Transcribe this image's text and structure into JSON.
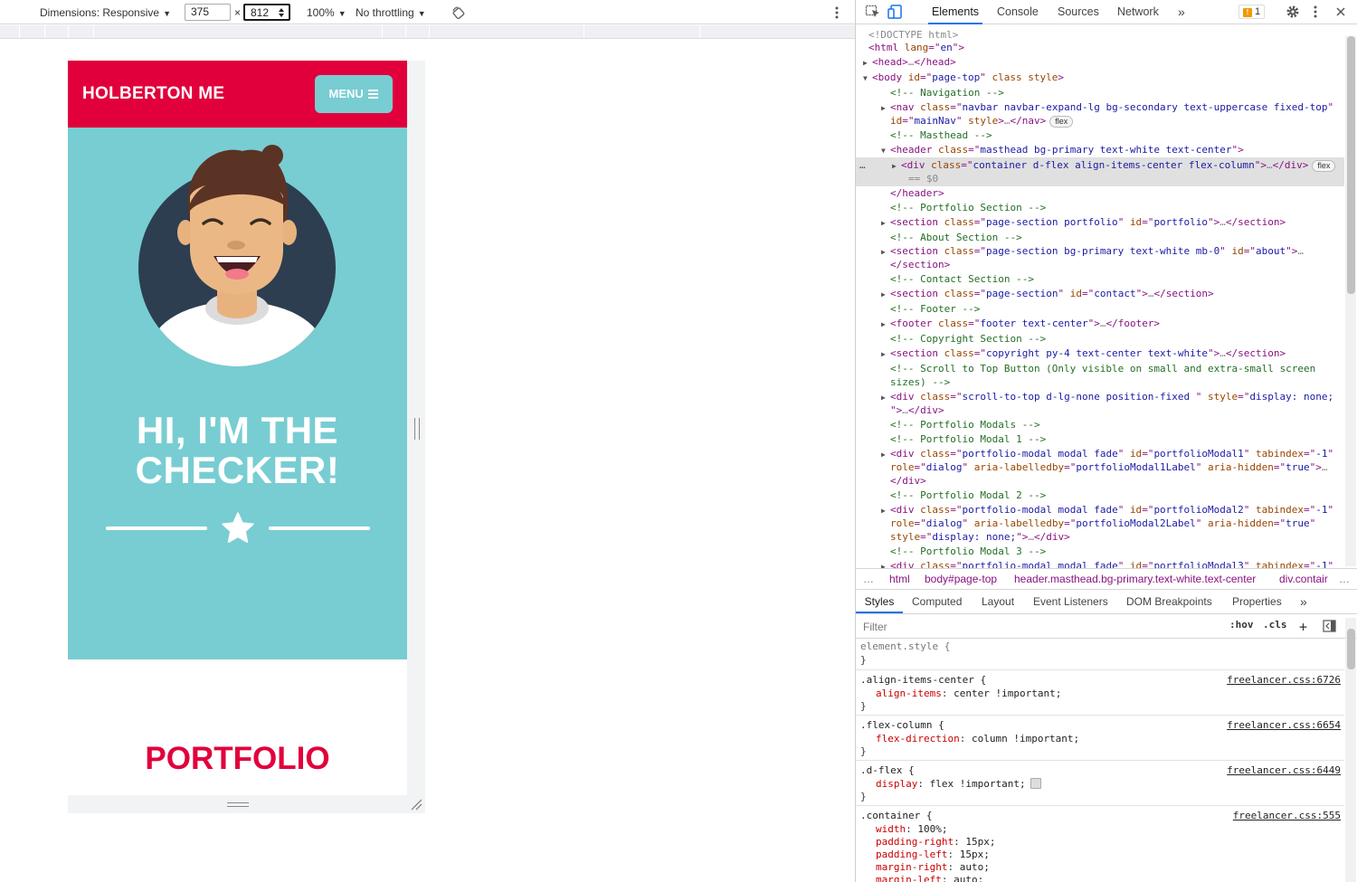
{
  "device_toolbar": {
    "dimensions_label": "Dimensions: Responsive",
    "width_value": "375",
    "times_sign": "×",
    "height_value": "812",
    "zoom_label": "100%",
    "throttling_label": "No throttling",
    "rotate_icon": "rotate-icon",
    "more_icon": "more-vertical-icon"
  },
  "site": {
    "brand": "HOLBERTON ME",
    "menu_label": "MENU",
    "menu_icon": "hamburger-icon",
    "headline_line1": "HI, I'M THE",
    "headline_line2": "CHECKER!",
    "divider_icon": "star-icon",
    "portfolio_title": "PORTFOLIO",
    "colors": {
      "primary": "#e1003c",
      "secondary": "#78cdd2",
      "avatar_bg": "#2d3e50"
    }
  },
  "devtools": {
    "tabs": [
      "Elements",
      "Console",
      "Sources",
      "Network"
    ],
    "active_tab": "Elements",
    "more_tabs": "»",
    "issues_count": "1",
    "dom_lines": [
      {
        "segs": [
          [
            "p",
            "<!DOCTYPE html>"
          ]
        ]
      },
      {
        "segs": [
          [
            "t",
            "<html "
          ],
          [
            "a",
            "lang"
          ],
          [
            "t",
            "=\""
          ],
          [
            "v",
            "en"
          ],
          [
            "t",
            "\">"
          ]
        ]
      },
      {
        "segs": [
          [
            "t",
            "<head>"
          ],
          [
            "p",
            "…"
          ],
          [
            "t",
            "</head>"
          ]
        ]
      },
      {
        "segs": [
          [
            "t",
            "<body "
          ],
          [
            "a",
            "id"
          ],
          [
            "t",
            "=\""
          ],
          [
            "v",
            "page-top"
          ],
          [
            "t",
            "\" "
          ],
          [
            "a",
            "class style"
          ],
          [
            "t",
            ">"
          ]
        ]
      },
      {
        "segs": [
          [
            "c",
            "<!-- Navigation -->"
          ]
        ]
      },
      {
        "segs": [
          [
            "t",
            "<nav "
          ],
          [
            "a",
            "class"
          ],
          [
            "t",
            "=\""
          ],
          [
            "v",
            "navbar navbar-expand-lg bg-secondary text-uppercase fixed-top"
          ],
          [
            "t",
            "\""
          ]
        ]
      },
      {
        "segs": [
          [
            "a",
            "id"
          ],
          [
            "t",
            "=\""
          ],
          [
            "v",
            "mainNav"
          ],
          [
            "t",
            "\" "
          ],
          [
            "a",
            "style"
          ],
          [
            "t",
            ">"
          ],
          [
            "p",
            "…"
          ],
          [
            "t",
            "</nav>"
          ]
        ],
        "badge": "flex"
      },
      {
        "segs": [
          [
            "c",
            "<!-- Masthead -->"
          ]
        ]
      },
      {
        "segs": [
          [
            "t",
            "<header "
          ],
          [
            "a",
            "class"
          ],
          [
            "t",
            "=\""
          ],
          [
            "v",
            "masthead bg-primary text-white text-center"
          ],
          [
            "t",
            "\">"
          ]
        ]
      },
      {
        "segs": [
          [
            "t",
            "<div "
          ],
          [
            "a",
            "class"
          ],
          [
            "t",
            "=\""
          ],
          [
            "v",
            "container d-flex align-items-center flex-column"
          ],
          [
            "t",
            "\">"
          ],
          [
            "p",
            "…"
          ],
          [
            "t",
            "</div>"
          ]
        ],
        "badge": "flex"
      },
      {
        "segs": [
          [
            "p",
            "== $0"
          ]
        ]
      },
      {
        "segs": [
          [
            "t",
            "</header>"
          ]
        ]
      },
      {
        "segs": [
          [
            "c",
            "<!-- Portfolio Section -->"
          ]
        ]
      },
      {
        "segs": [
          [
            "t",
            "<section "
          ],
          [
            "a",
            "class"
          ],
          [
            "t",
            "=\""
          ],
          [
            "v",
            "page-section portfolio"
          ],
          [
            "t",
            "\" "
          ],
          [
            "a",
            "id"
          ],
          [
            "t",
            "=\""
          ],
          [
            "v",
            "portfolio"
          ],
          [
            "t",
            "\">"
          ],
          [
            "p",
            "…"
          ],
          [
            "t",
            "</section>"
          ]
        ]
      },
      {
        "segs": [
          [
            "c",
            "<!-- About Section -->"
          ]
        ]
      },
      {
        "segs": [
          [
            "t",
            "<section "
          ],
          [
            "a",
            "class"
          ],
          [
            "t",
            "=\""
          ],
          [
            "v",
            "page-section bg-primary text-white mb-0"
          ],
          [
            "t",
            "\" "
          ],
          [
            "a",
            "id"
          ],
          [
            "t",
            "=\""
          ],
          [
            "v",
            "about"
          ],
          [
            "t",
            "\">"
          ],
          [
            "p",
            "…"
          ]
        ]
      },
      {
        "segs": [
          [
            "t",
            "</section>"
          ]
        ]
      },
      {
        "segs": [
          [
            "c",
            "<!-- Contact Section -->"
          ]
        ]
      },
      {
        "segs": [
          [
            "t",
            "<section "
          ],
          [
            "a",
            "class"
          ],
          [
            "t",
            "=\""
          ],
          [
            "v",
            "page-section"
          ],
          [
            "t",
            "\" "
          ],
          [
            "a",
            "id"
          ],
          [
            "t",
            "=\""
          ],
          [
            "v",
            "contact"
          ],
          [
            "t",
            "\">"
          ],
          [
            "p",
            "…"
          ],
          [
            "t",
            "</section>"
          ]
        ]
      },
      {
        "segs": [
          [
            "c",
            "<!-- Footer -->"
          ]
        ]
      },
      {
        "segs": [
          [
            "t",
            "<footer "
          ],
          [
            "a",
            "class"
          ],
          [
            "t",
            "=\""
          ],
          [
            "v",
            "footer text-center"
          ],
          [
            "t",
            "\">"
          ],
          [
            "p",
            "…"
          ],
          [
            "t",
            "</footer>"
          ]
        ]
      },
      {
        "segs": [
          [
            "c",
            "<!-- Copyright Section -->"
          ]
        ]
      },
      {
        "segs": [
          [
            "t",
            "<section "
          ],
          [
            "a",
            "class"
          ],
          [
            "t",
            "=\""
          ],
          [
            "v",
            "copyright py-4 text-center text-white"
          ],
          [
            "t",
            "\">"
          ],
          [
            "p",
            "…"
          ],
          [
            "t",
            "</section>"
          ]
        ]
      },
      {
        "segs": [
          [
            "c",
            "<!-- Scroll to Top Button (Only visible on small and extra-small screen"
          ]
        ]
      },
      {
        "segs": [
          [
            "c",
            "sizes) -->"
          ]
        ]
      },
      {
        "segs": [
          [
            "t",
            "<div "
          ],
          [
            "a",
            "class"
          ],
          [
            "t",
            "=\""
          ],
          [
            "v",
            "scroll-to-top d-lg-none position-fixed "
          ],
          [
            "t",
            "\" "
          ],
          [
            "a",
            "style"
          ],
          [
            "t",
            "=\""
          ],
          [
            "v",
            "display: none;"
          ]
        ]
      },
      {
        "segs": [
          [
            "t",
            "\">"
          ],
          [
            "p",
            "…"
          ],
          [
            "t",
            "</div>"
          ]
        ]
      },
      {
        "segs": [
          [
            "c",
            "<!-- Portfolio Modals -->"
          ]
        ]
      },
      {
        "segs": [
          [
            "c",
            "<!-- Portfolio Modal 1 -->"
          ]
        ]
      },
      {
        "segs": [
          [
            "t",
            "<div "
          ],
          [
            "a",
            "class"
          ],
          [
            "t",
            "=\""
          ],
          [
            "v",
            "portfolio-modal modal fade"
          ],
          [
            "t",
            "\" "
          ],
          [
            "a",
            "id"
          ],
          [
            "t",
            "=\""
          ],
          [
            "v",
            "portfolioModal1"
          ],
          [
            "t",
            "\" "
          ],
          [
            "a",
            "tabindex"
          ],
          [
            "t",
            "=\""
          ],
          [
            "v",
            "-1"
          ],
          [
            "t",
            "\""
          ]
        ]
      },
      {
        "segs": [
          [
            "a",
            "role"
          ],
          [
            "t",
            "=\""
          ],
          [
            "v",
            "dialog"
          ],
          [
            "t",
            "\" "
          ],
          [
            "a",
            "aria-labelledby"
          ],
          [
            "t",
            "=\""
          ],
          [
            "v",
            "portfolioModal1Label"
          ],
          [
            "t",
            "\" "
          ],
          [
            "a",
            "aria-hidden"
          ],
          [
            "t",
            "=\""
          ],
          [
            "v",
            "true"
          ],
          [
            "t",
            "\">"
          ],
          [
            "p",
            "…"
          ]
        ]
      },
      {
        "segs": [
          [
            "t",
            "</div>"
          ]
        ]
      },
      {
        "segs": [
          [
            "c",
            "<!-- Portfolio Modal 2 -->"
          ]
        ]
      },
      {
        "segs": [
          [
            "t",
            "<div "
          ],
          [
            "a",
            "class"
          ],
          [
            "t",
            "=\""
          ],
          [
            "v",
            "portfolio-modal modal fade"
          ],
          [
            "t",
            "\" "
          ],
          [
            "a",
            "id"
          ],
          [
            "t",
            "=\""
          ],
          [
            "v",
            "portfolioModal2"
          ],
          [
            "t",
            "\" "
          ],
          [
            "a",
            "tabindex"
          ],
          [
            "t",
            "=\""
          ],
          [
            "v",
            "-1"
          ],
          [
            "t",
            "\""
          ]
        ]
      },
      {
        "segs": [
          [
            "a",
            "role"
          ],
          [
            "t",
            "=\""
          ],
          [
            "v",
            "dialog"
          ],
          [
            "t",
            "\" "
          ],
          [
            "a",
            "aria-labelledby"
          ],
          [
            "t",
            "=\""
          ],
          [
            "v",
            "portfolioModal2Label"
          ],
          [
            "t",
            "\" "
          ],
          [
            "a",
            "aria-hidden"
          ],
          [
            "t",
            "=\""
          ],
          [
            "v",
            "true"
          ],
          [
            "t",
            "\""
          ]
        ]
      },
      {
        "segs": [
          [
            "a",
            "style"
          ],
          [
            "t",
            "=\""
          ],
          [
            "v",
            "display: none;"
          ],
          [
            "t",
            "\">"
          ],
          [
            "p",
            "…"
          ],
          [
            "t",
            "</div>"
          ]
        ]
      },
      {
        "segs": [
          [
            "c",
            "<!-- Portfolio Modal 3 -->"
          ]
        ]
      },
      {
        "segs": [
          [
            "t",
            "<div "
          ],
          [
            "a",
            "class"
          ],
          [
            "t",
            "=\""
          ],
          [
            "v",
            "portfolio-modal modal fade"
          ],
          [
            "t",
            "\" "
          ],
          [
            "a",
            "id"
          ],
          [
            "t",
            "=\""
          ],
          [
            "v",
            "portfolioModal3"
          ],
          [
            "t",
            "\" "
          ],
          [
            "a",
            "tabindex"
          ],
          [
            "t",
            "=\""
          ],
          [
            "v",
            "-1"
          ],
          [
            "t",
            "\""
          ]
        ]
      }
    ],
    "breadcrumbs": [
      "…",
      "html",
      "body#page-top",
      "header.masthead.bg-primary.text-white.text-center",
      "div.contair",
      "…"
    ],
    "sub_tabs": [
      "Styles",
      "Computed",
      "Layout",
      "Event Listeners",
      "DOM Breakpoints",
      "Properties"
    ],
    "active_sub_tab": "Styles",
    "more_sub_tabs": "»",
    "filter_placeholder": "Filter",
    "hov_label": ":hov",
    "cls_label": ".cls",
    "add_rule_label": "+",
    "style_rules": [
      {
        "selector": "element.style {",
        "source": "",
        "props": [],
        "close": "}"
      },
      {
        "selector": ".align-items-center {",
        "source": "freelancer.css:6726",
        "props": [
          [
            "align-items",
            "center !important;"
          ]
        ],
        "close": "}"
      },
      {
        "selector": ".flex-column {",
        "source": "freelancer.css:6654",
        "props": [
          [
            "flex-direction",
            "column !important;"
          ]
        ],
        "close": "}"
      },
      {
        "selector": ".d-flex {",
        "source": "freelancer.css:6449",
        "props": [
          [
            "display",
            "flex !important;"
          ]
        ],
        "close": "}"
      },
      {
        "selector": ".container {",
        "source": "freelancer.css:555",
        "props": [
          [
            "width",
            "100%;"
          ],
          [
            "padding-right",
            "15px;"
          ],
          [
            "padding-left",
            "15px;"
          ],
          [
            "margin-right",
            "auto;"
          ],
          [
            "margin-left",
            "auto;"
          ]
        ],
        "close": ""
      }
    ]
  }
}
